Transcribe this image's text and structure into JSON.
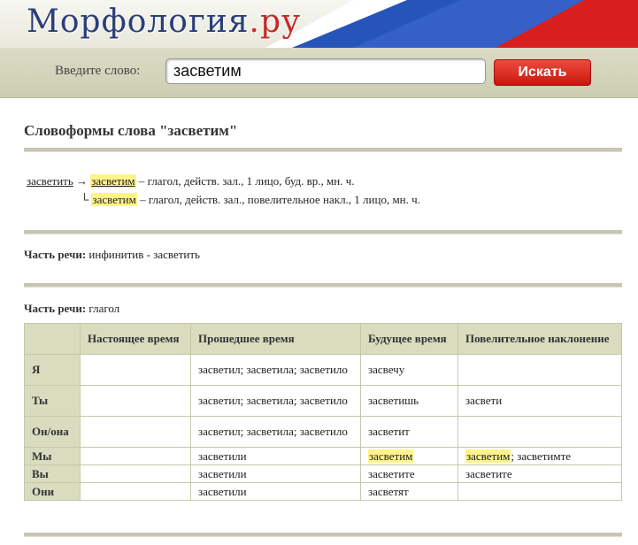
{
  "header": {
    "logo_main": "Морфология",
    "logo_dot": ".",
    "logo_ru": "ру"
  },
  "search": {
    "label": "Введите слово:",
    "value": "засветим",
    "button_label": "Искать"
  },
  "page_title": "Словоформы слова \"засветим\"",
  "forms": {
    "line1": {
      "lemma": "засветить",
      "arrow": "→",
      "form": "засветим",
      "desc": " – глагол, действ. зал., 1 лицо, буд. вр., мн. ч."
    },
    "line2": {
      "branch": "└",
      "form": "засветим",
      "desc": " – глагол, действ. зал., повелительное накл., 1 лицо, мн. ч."
    }
  },
  "pos1": {
    "label": "Часть речи:",
    "value": " инфинитив - засветить"
  },
  "pos2": {
    "label": "Часть речи:",
    "value": " глагол"
  },
  "table": {
    "headers": [
      "",
      "Настоящее время",
      "Прошедшее время",
      "Будущее время",
      "Повелительное наклонение"
    ],
    "rows": [
      {
        "person": "Я",
        "present": "",
        "past": "засветил; засветила; засветило",
        "future": "засвечу",
        "imperative": ""
      },
      {
        "person": "Ты",
        "present": "",
        "past": "засветил; засветила; засветило",
        "future": "засветишь",
        "imperative": "засвети"
      },
      {
        "person": "Он/она",
        "present": "",
        "past": "засветил; засветила; засветило",
        "future": "засветит",
        "imperative": ""
      },
      {
        "person": "Мы",
        "present": "",
        "past": "засветили",
        "future": "засветим",
        "imperative_hl": "засветим",
        "imperative_rest": "; засветимте"
      },
      {
        "person": "Вы",
        "present": "",
        "past": "засветили",
        "future": "засветите",
        "imperative": "засветите"
      },
      {
        "person": "Они",
        "present": "",
        "past": "засветили",
        "future": "засветят",
        "imperative": ""
      }
    ]
  },
  "colors": {
    "accent_red": "#c8180e",
    "logo_blue": "#2a3f7a",
    "highlight": "#fff48a",
    "table_head": "#d9dcbf"
  }
}
